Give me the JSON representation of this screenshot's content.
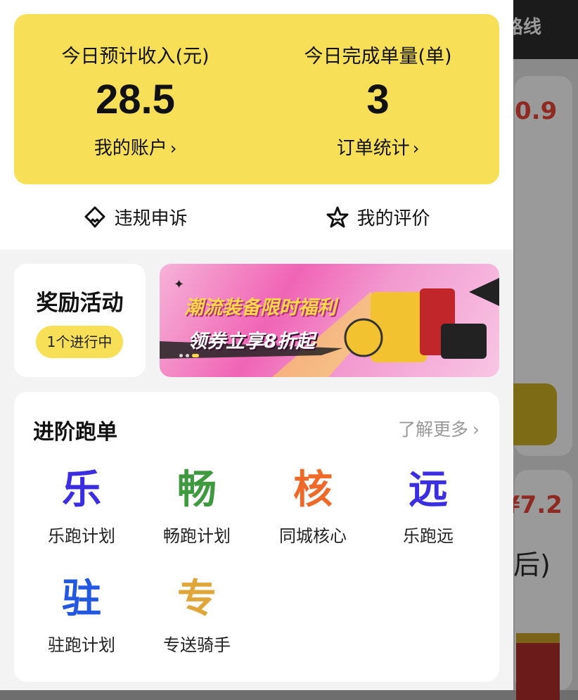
{
  "background": {
    "route_label": "路线",
    "price_1": "0.9",
    "price_2": "¥7.2",
    "bracket": "后)"
  },
  "income": {
    "left": {
      "label": "今日预计收入(元)",
      "value": "28.5",
      "link": "我的账户"
    },
    "right": {
      "label": "今日完成单量(单)",
      "value": "3",
      "link": "订单统计"
    },
    "arrow": "›"
  },
  "quick_actions": [
    {
      "label": "违规申诉",
      "icon": "appeal-icon"
    },
    {
      "label": "我的评价",
      "icon": "star-icon"
    }
  ],
  "reward": {
    "title": "奖励活动",
    "badge": "1个进行中"
  },
  "banner": {
    "line1": "潮流装备限时福利",
    "line2": "领券立享8折起"
  },
  "advanced": {
    "title": "进阶跑单",
    "more": "了解更多",
    "more_chevron": "›",
    "items": [
      {
        "glyph": "乐",
        "label": "乐跑计划",
        "color": "#3a2ee0"
      },
      {
        "glyph": "畅",
        "label": "畅跑计划",
        "color": "#3f9a3f"
      },
      {
        "glyph": "核",
        "label": "同城核心",
        "color": "#ef6a28"
      },
      {
        "glyph": "远",
        "label": "乐跑远",
        "color": "#3a2ee0"
      },
      {
        "glyph": "驻",
        "label": "驻跑计划",
        "color": "#2257e0"
      },
      {
        "glyph": "专",
        "label": "专送骑手",
        "color": "#e0a63a"
      }
    ]
  }
}
